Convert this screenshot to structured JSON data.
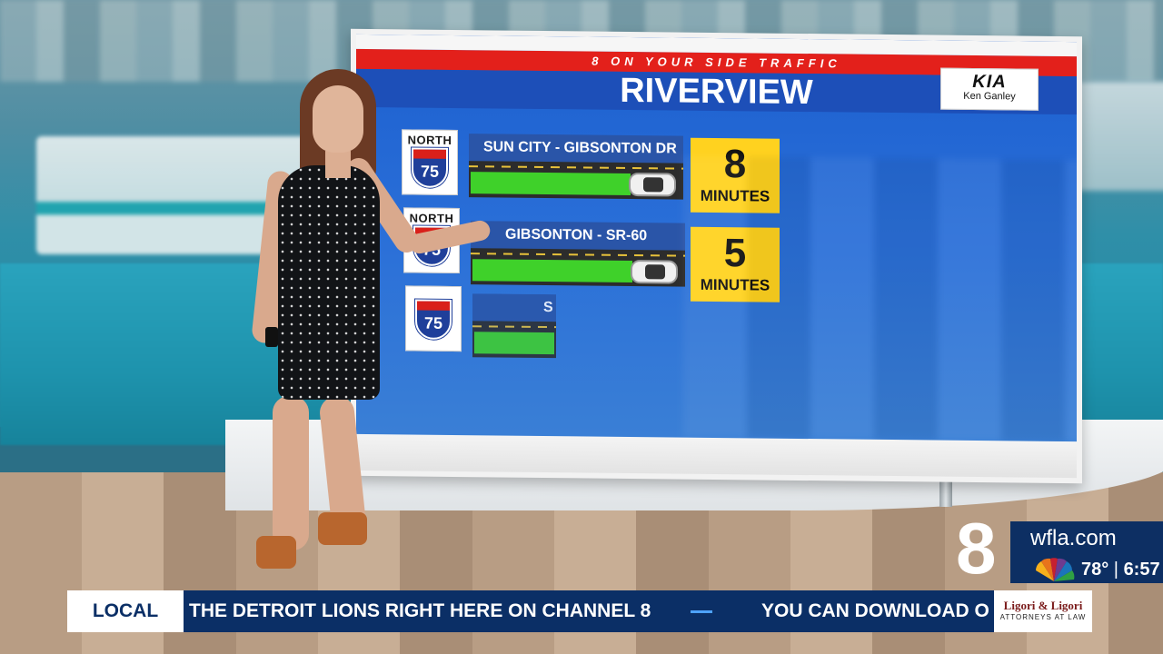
{
  "board": {
    "banner": "8 ON YOUR SIDE TRAFFIC",
    "title": "RIVERVIEW",
    "sponsor": {
      "brand": "KIA",
      "dealer": "Ken Ganley"
    },
    "routes": [
      {
        "direction": "NORTH",
        "highway": "75",
        "segment": "SUN CITY - GIBSONTON DR",
        "time": "8",
        "unit": "MINUTES",
        "flow_fraction": 0.76
      },
      {
        "direction": "NORTH",
        "highway": "75",
        "segment": "GIBSONTON - SR-60",
        "time": "5",
        "unit": "MINUTES",
        "flow_fraction": 0.76
      },
      {
        "direction": "",
        "highway": "75",
        "segment": "S",
        "time": "",
        "unit": "",
        "flow_fraction": 0.38
      }
    ]
  },
  "bug": {
    "channel": "8",
    "site": "wfla.com",
    "temperature": "78°",
    "time": "6:57"
  },
  "ticker": {
    "label": "LOCAL",
    "message_1": "THE DETROIT LIONS RIGHT HERE ON CHANNEL 8",
    "message_2": "YOU CAN DOWNLOAD O",
    "sponsor_name": "Ligori & Ligori",
    "sponsor_sub": "ATTORNEYS AT LAW"
  },
  "colors": {
    "board_blue": "#1d4fb8",
    "banner_red": "#e3201b",
    "flow_green": "#3fd12a",
    "time_yellow": "#ffd21f",
    "ticker_navy": "#0b2f66"
  }
}
